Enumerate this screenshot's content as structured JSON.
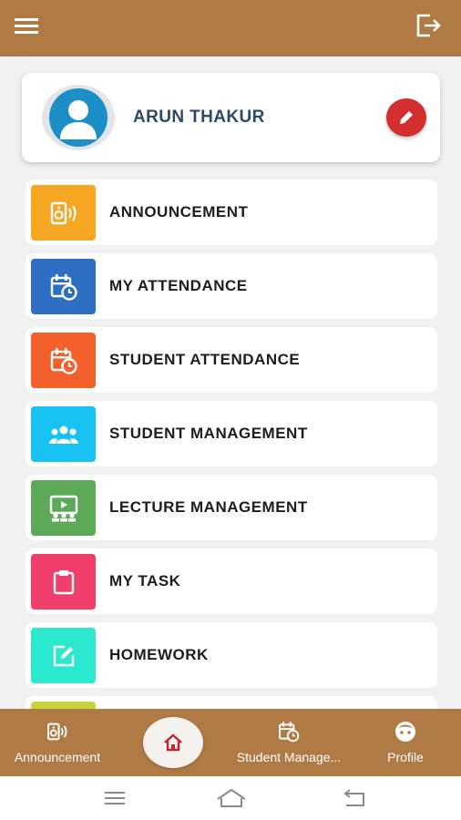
{
  "header": {
    "menu_icon": "hamburger-menu-icon",
    "logout_icon": "logout-icon",
    "background": "#b07a45"
  },
  "profile": {
    "name": "ARUN THAKUR",
    "avatar_icon": "person-avatar-icon",
    "edit_icon": "pencil-icon",
    "edit_color": "#d32f2f"
  },
  "menu": {
    "items": [
      {
        "label": "ANNOUNCEMENT",
        "icon": "speaker-icon",
        "color": "#f5a623"
      },
      {
        "label": "MY ATTENDANCE",
        "icon": "calendar-clock-icon",
        "color": "#2e6fc3"
      },
      {
        "label": "STUDENT ATTENDANCE",
        "icon": "calendar-clock-icon",
        "color": "#f4602b"
      },
      {
        "label": "STUDENT MANAGEMENT",
        "icon": "group-icon",
        "color": "#18c2f2"
      },
      {
        "label": "LECTURE MANAGEMENT",
        "icon": "lecture-screen-icon",
        "color": "#5caa57"
      },
      {
        "label": "MY TASK",
        "icon": "clipboard-icon",
        "color": "#ef3f6a"
      },
      {
        "label": "HOMEWORK",
        "icon": "edit-square-icon",
        "color": "#2ce8cf"
      },
      {
        "label": "",
        "icon": "",
        "color": "#c8d43a"
      }
    ]
  },
  "bottom_nav": {
    "announcement": {
      "label": "Announcement",
      "icon": "speaker-icon"
    },
    "home": {
      "icon": "home-icon"
    },
    "student_management": {
      "label": "Student Manage...",
      "icon": "calendar-clock-icon"
    },
    "profile": {
      "label": "Profile",
      "icon": "face-icon"
    }
  },
  "system_bar": {
    "recents_icon": "recents-icon",
    "home_icon": "system-home-icon",
    "back_icon": "back-icon"
  }
}
